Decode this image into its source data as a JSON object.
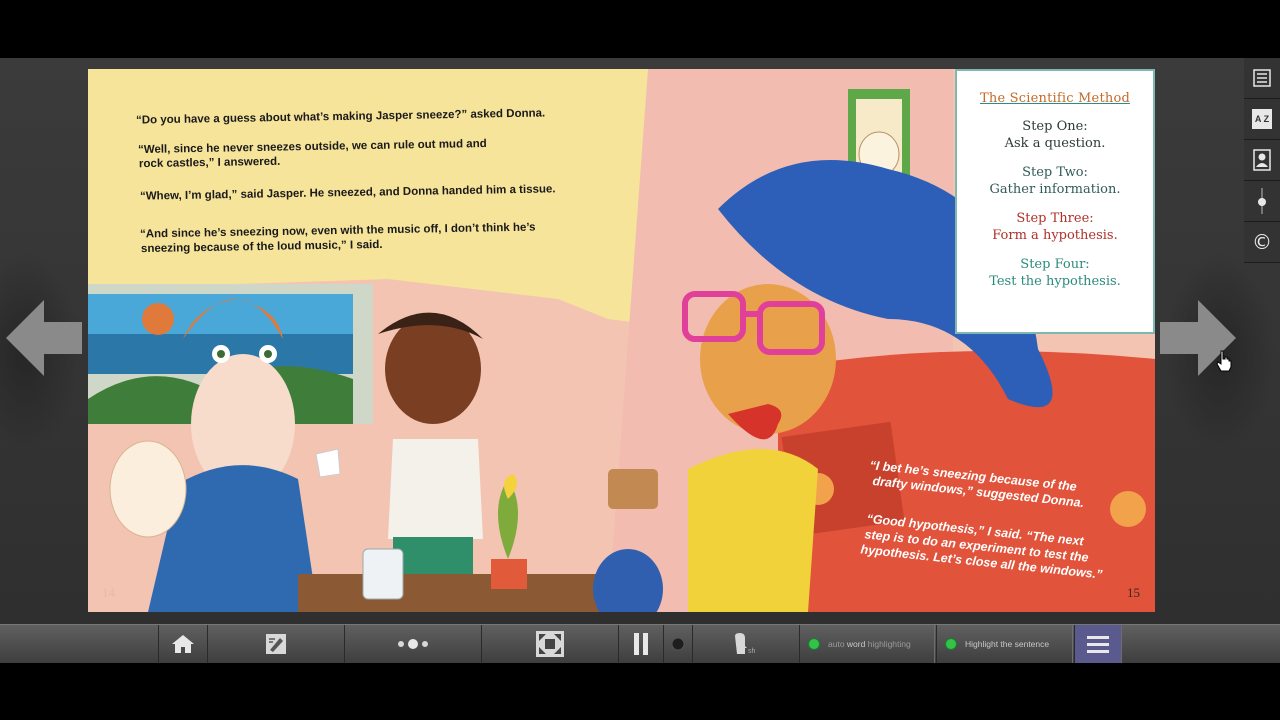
{
  "story_left": {
    "lines": [
      "“Do you have a guess about what’s making Jasper sneeze?” asked Donna.",
      "“Well, since he never sneezes outside, we can rule out mud and",
      "rock castles,” I answered.",
      "“Whew, I’m glad,” said Jasper. He sneezed, and Donna handed him a tissue.",
      "“And since he’s sneezing now, even with the music off, I don’t think he’s",
      "sneezing because of the loud music,” I said."
    ],
    "page_number": "14"
  },
  "story_right": {
    "lines": [
      "“I bet he’s sneezing because of the",
      "drafty windows,” suggested Donna.",
      "“Good hypothesis,” I said. “The next",
      "step is to do an experiment to test the",
      "hypothesis. Let’s close all the windows.”"
    ],
    "page_number": "15"
  },
  "scientific_method": {
    "title": "The Scientific Method",
    "steps": [
      {
        "label": "Step One:",
        "text": "Ask a question."
      },
      {
        "label": "Step Two:",
        "text": "Gather information."
      },
      {
        "label": "Step Three:",
        "text": "Form a hypothesis."
      },
      {
        "label": "Step Four:",
        "text": "Test the hypothesis."
      }
    ]
  },
  "right_toolbar": {
    "items": [
      "list-icon",
      "az-icon",
      "user-card-icon",
      "slider-icon",
      "copyright-icon"
    ],
    "az_label": "A Z",
    "copyright_label": "©"
  },
  "bottom_bar": {
    "auto_word": {
      "prefix": "auto",
      "word": "word",
      "suffix": "highlighting"
    },
    "highlight_sentence": "Highlight the sentence"
  },
  "colors": {
    "accent_green": "#33c24a",
    "menu_purple": "#5b5a8e",
    "sci_title_orange": "#c46a28",
    "step_red": "#b03028",
    "step_teal": "#2a8a7e"
  }
}
